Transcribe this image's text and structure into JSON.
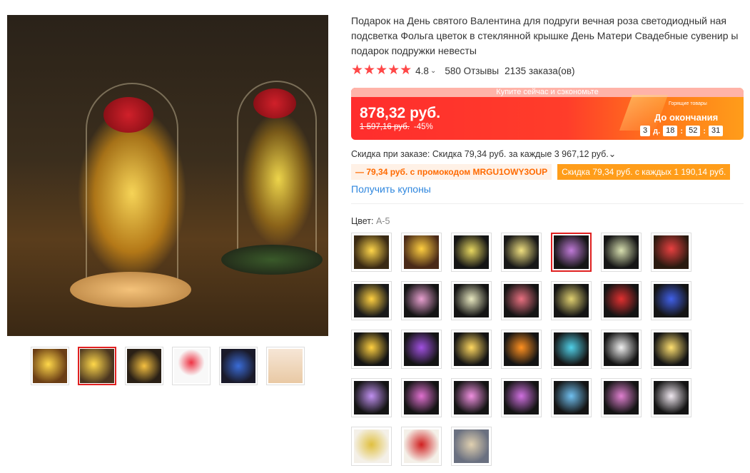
{
  "product": {
    "title": "Подарок на День святого Валентина для подруги вечная роза светодиодный ная подсветка Фольга цветок в стеклянной крышке День Матери Свадебные сувенир ы подарок подружки невесты",
    "stars": "★★★★★",
    "rating": "4.8",
    "rating_chevron": "⌄",
    "reviews": "580 Отзывы",
    "orders": "2135 заказа(ов)"
  },
  "banner": {
    "top_text": "Купите сейчас и сэкономьте",
    "price": "878,32 руб.",
    "old_price": "1 597,16 руб.",
    "discount_pct": "-45%",
    "hot_label": "Горящие товары",
    "ends_label": "До окончания",
    "timer_days": "3",
    "timer_days_unit": "д.",
    "timer_hours": "18",
    "timer_minutes": "52",
    "timer_seconds": "31",
    "timer_sep": ":"
  },
  "discount": {
    "line": "Скидка при заказе: Скидка 79,34 руб. за каждые 3 967,12 руб.⌄",
    "promo_tag": "— 79,34 руб. с промокодом MRGU1OWY3OUP",
    "store_tag": "Скидка 79,34 руб. с каждых 1 190,14 руб."
  },
  "coupons_link": "Получить купоны",
  "color": {
    "label": "Цвет:",
    "value": "A-5"
  },
  "colors": {
    "primary_red": "#ff4747",
    "link_blue": "#2e86de",
    "selected_border": "#e02020"
  },
  "thumbnails": [
    {
      "id": "gallery-thumb-1",
      "active": false
    },
    {
      "id": "gallery-thumb-2",
      "active": true
    },
    {
      "id": "gallery-thumb-3",
      "active": false
    },
    {
      "id": "gallery-thumb-4",
      "active": false
    },
    {
      "id": "gallery-thumb-5",
      "active": false
    },
    {
      "id": "gallery-thumb-6",
      "active": false
    }
  ],
  "swatch_selected_index": 4,
  "swatch_count": 31
}
